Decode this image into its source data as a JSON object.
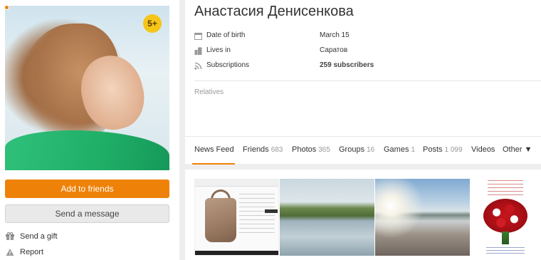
{
  "profile": {
    "name": "Анастасия Денисенкова",
    "age_badge": "5+",
    "info": [
      {
        "label": "Date of birth",
        "value": "March 15",
        "icon": "calendar-icon"
      },
      {
        "label": "Lives in",
        "value": "Саратов",
        "icon": "buildings-icon"
      },
      {
        "label": "Subscriptions",
        "value": "259 subscribers",
        "icon": "rss-icon"
      }
    ],
    "relatives_label": "Relatives"
  },
  "actions": {
    "add_friend": "Add to friends",
    "send_message": "Send a message",
    "send_gift": "Send a gift",
    "report": "Report"
  },
  "tabs": [
    {
      "label": "News Feed",
      "count": ""
    },
    {
      "label": "Friends",
      "count": "683"
    },
    {
      "label": "Photos",
      "count": "365"
    },
    {
      "label": "Groups",
      "count": "16"
    },
    {
      "label": "Games",
      "count": "1"
    },
    {
      "label": "Posts",
      "count": "1 099"
    },
    {
      "label": "Videos",
      "count": ""
    },
    {
      "label": "Other ▼",
      "count": ""
    }
  ],
  "colors": {
    "accent": "#ee8208",
    "badge": "#f5c518",
    "background": "#eeeeee"
  }
}
